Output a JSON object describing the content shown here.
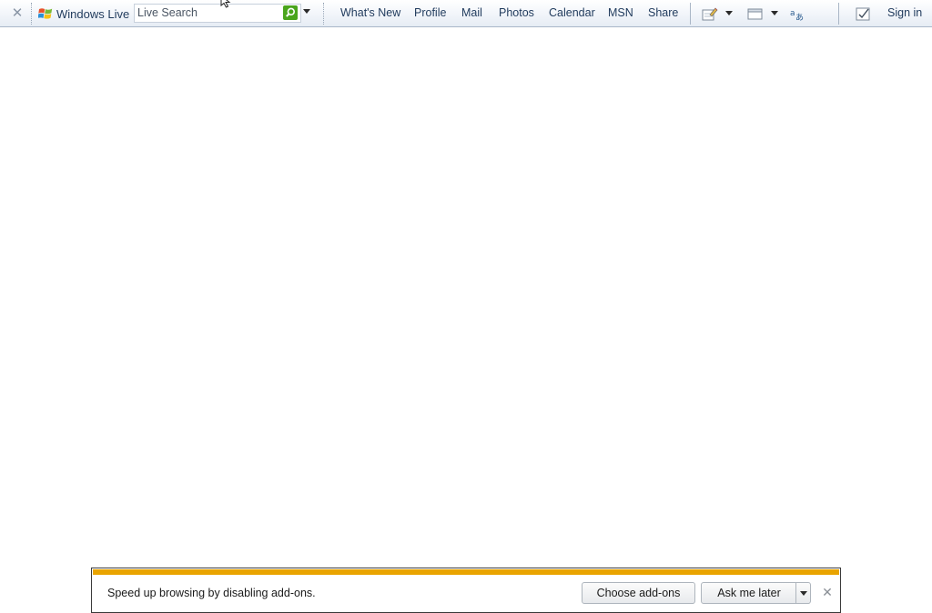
{
  "toolbar": {
    "close_icon": "close-icon",
    "brand": {
      "icon": "windows-flag-icon",
      "label": "Windows Live"
    },
    "search": {
      "value": "Live Search",
      "go_icon": "search-icon",
      "dropdown_icon": "chevron-down-icon"
    },
    "nav": [
      "What's New",
      "Profile",
      "Mail",
      "Photos",
      "Calendar",
      "MSN",
      "Share"
    ],
    "tools": [
      {
        "icon": "highlight-pen-icon",
        "has_dropdown": true
      },
      {
        "icon": "window-icon",
        "has_dropdown": true
      },
      {
        "icon": "translate-icon",
        "has_dropdown": false
      }
    ],
    "signin": {
      "icon": "checkbox-icon",
      "label": "Sign in"
    }
  },
  "notification": {
    "message": "Speed up browsing by disabling add-ons.",
    "choose_label": "Choose add-ons",
    "later_label": "Ask me later",
    "stripe_color": "#e9a400"
  }
}
